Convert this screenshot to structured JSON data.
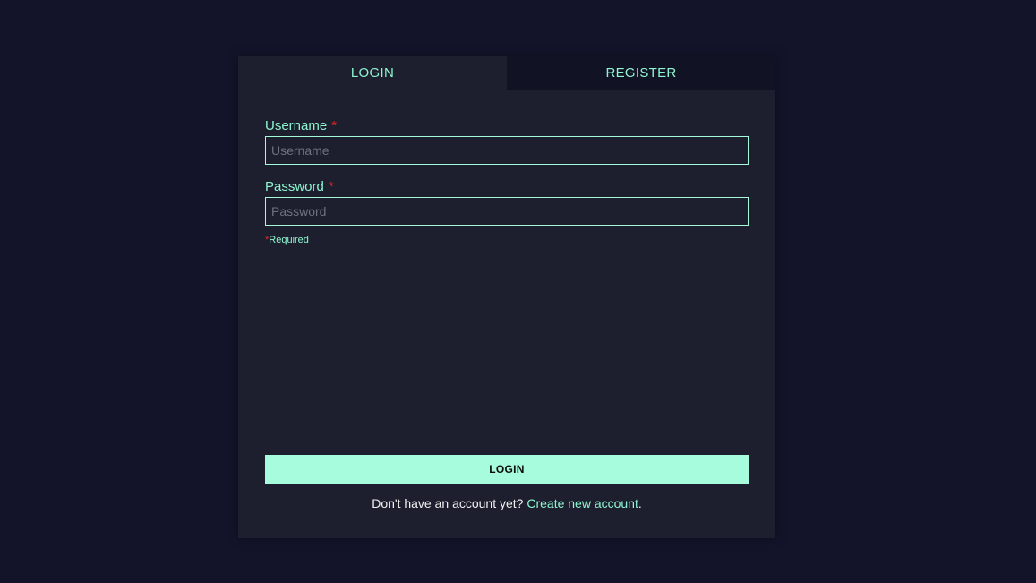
{
  "tabs": [
    {
      "label": "LOGIN",
      "active": true
    },
    {
      "label": "REGISTER",
      "active": false
    }
  ],
  "form": {
    "username": {
      "label": "Username",
      "required_mark": "*",
      "placeholder": "Username",
      "value": ""
    },
    "password": {
      "label": "Password",
      "required_mark": "*",
      "placeholder": "Password",
      "value": ""
    },
    "required_note": {
      "mark": "*",
      "text": "Required"
    },
    "submit_label": "LOGIN"
  },
  "footer": {
    "prompt": "Don't have an account yet? ",
    "link": "Create new account",
    "suffix": "."
  },
  "colors": {
    "background": "#13142a",
    "card": "#1d1f2e",
    "accent": "#a6fcdc",
    "required": "#e0282b"
  }
}
